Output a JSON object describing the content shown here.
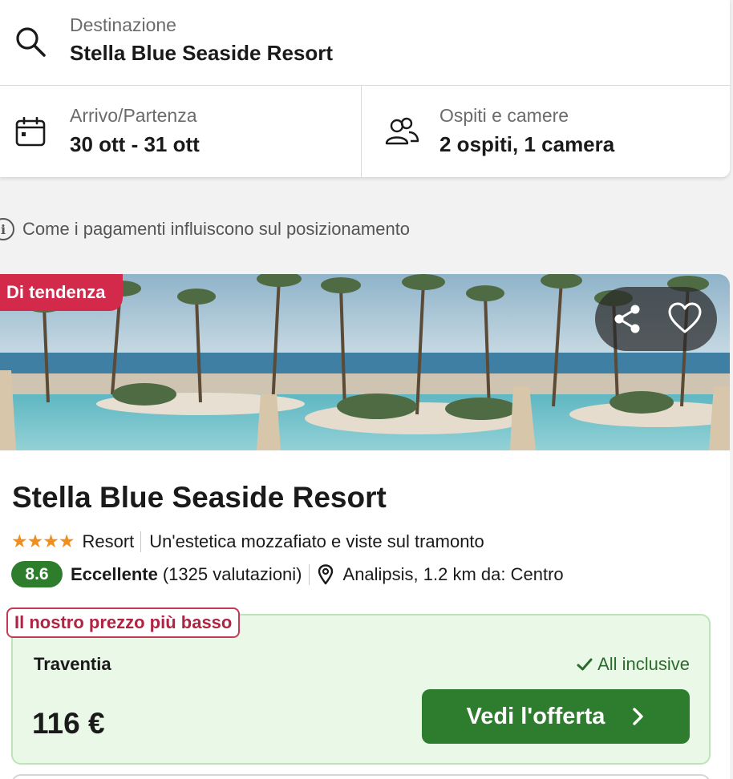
{
  "search": {
    "destination_label": "Destinazione",
    "destination_value": "Stella Blue Seaside Resort",
    "dates_label": "Arrivo/Partenza",
    "dates_value": "30 ott - 31 ott",
    "guests_label": "Ospiti e camere",
    "guests_value": "2 ospiti, 1 camera"
  },
  "info": {
    "text": "Come i pagamenti influiscono sul posizionamento",
    "icon": "info-icon"
  },
  "hotel": {
    "badge": "Di tendenza",
    "name": "Stella Blue Seaside Resort",
    "stars": "★★★★",
    "star_count": 4,
    "type": "Resort",
    "tagline": "Un'estetica mozzafiato e viste sul tramonto",
    "score": "8.6",
    "score_word": "Eccellente",
    "reviews": "(1325 valutazioni)",
    "location": "Analipsis, 1.2 km da: Centro",
    "icons": [
      "share-icon",
      "heart-icon",
      "map-pin-icon"
    ]
  },
  "offer": {
    "tag": "Il nostro prezzo più basso",
    "provider": "Traventia",
    "inclusive": "All inclusive",
    "price": "116 €",
    "cta": "Vedi l'offerta"
  },
  "colors": {
    "accent_green": "#2e7d2e",
    "trend_badge": "#d3294b",
    "star": "#f08e1f",
    "offer_bg": "#eaf8e8"
  }
}
